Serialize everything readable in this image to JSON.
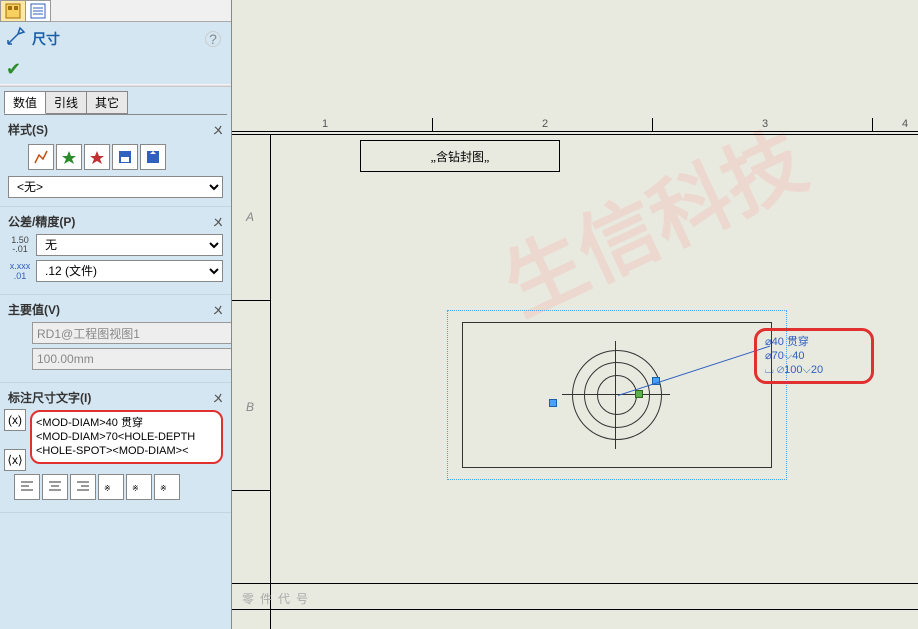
{
  "panel": {
    "title": "尺寸",
    "tabs": {
      "values": "数值",
      "leaders": "引线",
      "other": "其它"
    },
    "style": {
      "header": "样式(S)",
      "dropdown": "<无>"
    },
    "tolerance": {
      "header": "公差/精度(P)",
      "type": "无",
      "precision": ".12 (文件)"
    },
    "primary": {
      "header": "主要值(V)",
      "name": "RD1@工程图视图1",
      "value": "100.00mm"
    },
    "dimtext": {
      "header": "标注尺寸文字(I)",
      "line1": "<MOD-DIAM>40 贯穿",
      "line2": "<MOD-DIAM>70<HOLE-DEPTH",
      "line3": "<HOLE-SPOT><MOD-DIAM><"
    }
  },
  "drawing": {
    "cols": [
      "1",
      "2",
      "3",
      "4"
    ],
    "rowA": "A",
    "rowB": "B",
    "title_block": "„含钻封图„",
    "spec_label": "零件代号",
    "callout": {
      "line1": "⌀40 贯穿",
      "line2": "⌀70⌵40",
      "line3": "⌴ ⌀100⌵20"
    }
  },
  "watermark": {
    "line1": "生信科技"
  }
}
